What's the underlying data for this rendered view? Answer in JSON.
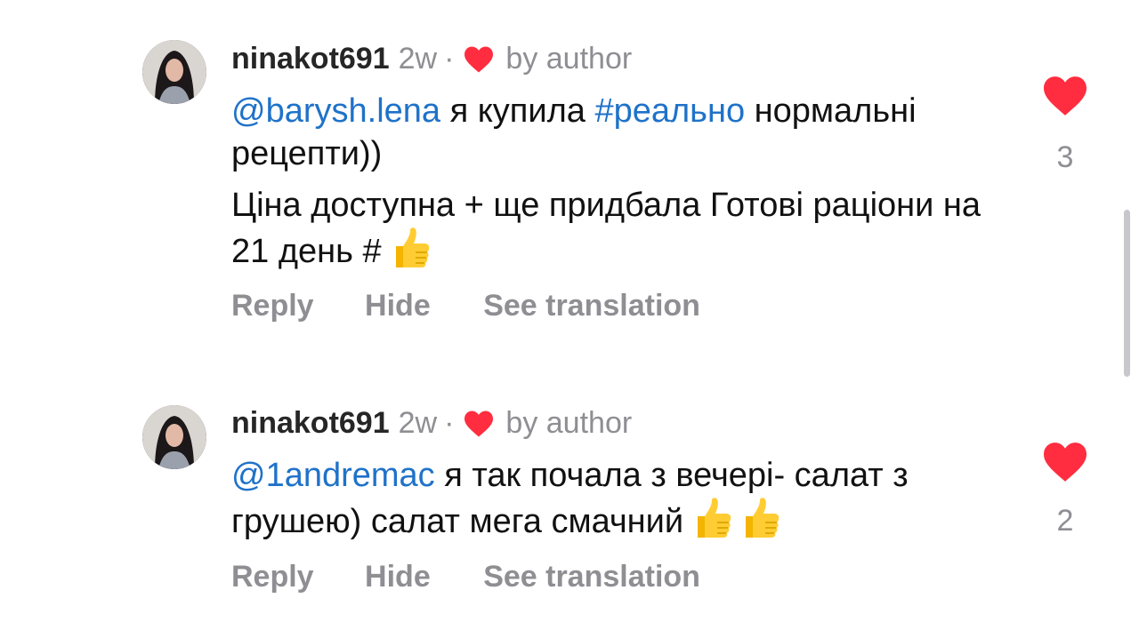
{
  "comments": [
    {
      "username": "ninakot691",
      "time": "2w",
      "separator": "·",
      "by_author": "by author",
      "paragraph1": {
        "mention": "@barysh.lena",
        "text_a": " я купила ",
        "hashtag": "#реально",
        "text_b": " нормальні рецепти))"
      },
      "paragraph2": {
        "text": "Ціна доступна + ще придбала Готові раціони на 21 день #"
      },
      "likes": "3",
      "actions": {
        "reply": "Reply",
        "hide": "Hide",
        "translate": "See translation"
      }
    },
    {
      "username": "ninakot691",
      "time": "2w",
      "separator": "·",
      "by_author": "by author",
      "paragraph1": {
        "mention": "@1andremac",
        "text_a": " я так почала з вечері- салат з грушею)  салат мега смачний"
      },
      "likes": "2",
      "actions": {
        "reply": "Reply",
        "hide": "Hide",
        "translate": "See translation"
      }
    }
  ],
  "colors": {
    "link": "#1f72c9",
    "like_red": "#ff2d3f",
    "secondary_text": "#8e8e93"
  }
}
